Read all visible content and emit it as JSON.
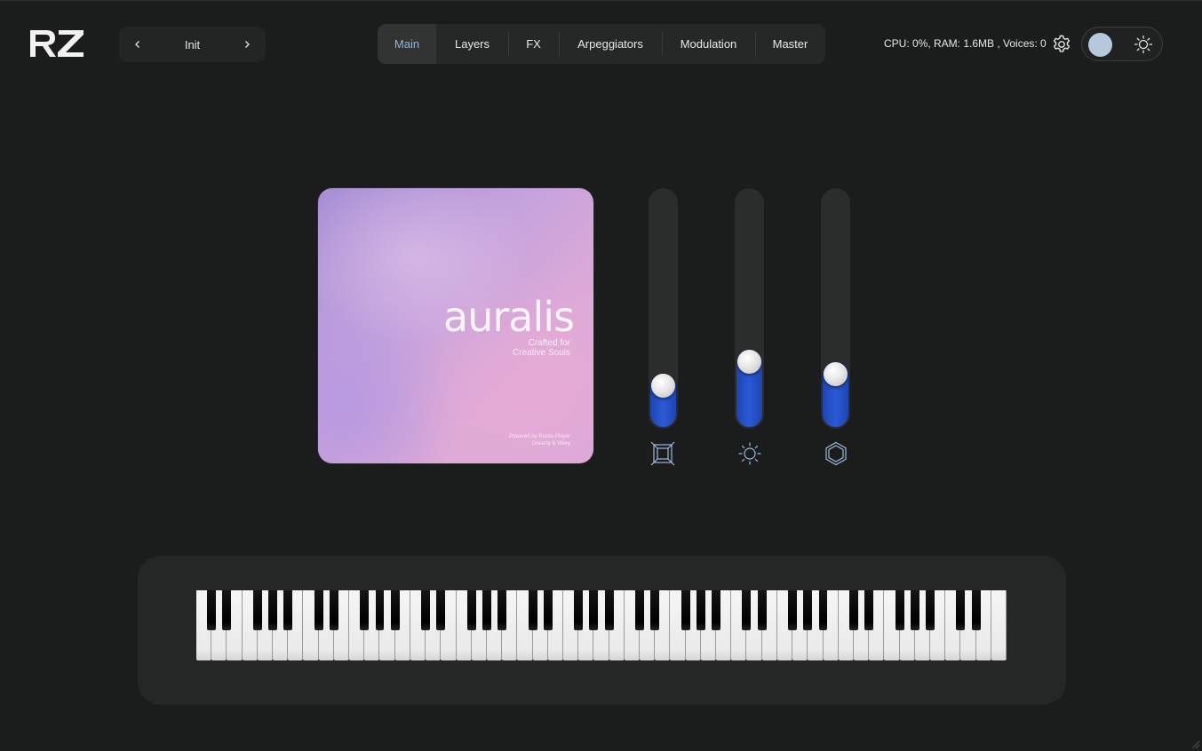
{
  "app": {
    "logo_text": "RZ"
  },
  "preset": {
    "name": "Init",
    "prev_icon": "chevron-left-icon",
    "next_icon": "chevron-right-icon"
  },
  "tabs": [
    {
      "label": "Main",
      "active": true
    },
    {
      "label": "Layers",
      "active": false
    },
    {
      "label": "FX",
      "active": false
    },
    {
      "label": "Arpeggiators",
      "active": false
    },
    {
      "label": "Modulation",
      "active": false
    },
    {
      "label": "Master",
      "active": false
    }
  ],
  "status": {
    "text": "CPU: 0%, RAM: 1.6MB , Voices: 0"
  },
  "header_icons": {
    "settings": "gear-icon",
    "theme_toggle_knob": "toggle-knob",
    "theme": "sun-icon"
  },
  "artwork": {
    "title": "auralis",
    "tagline_line1": "Crafted for",
    "tagline_line2": "Creative Souls",
    "footer_line1": "Powered by Rozos Player",
    "footer_line2": "Dreamy & Vibey"
  },
  "sliders": [
    {
      "icon": "square-frame-icon",
      "level": 0.14
    },
    {
      "icon": "sun-icon",
      "level": 0.24
    },
    {
      "icon": "hexagon-icon",
      "level": 0.19
    }
  ],
  "colors": {
    "accent": "#2b5ad6",
    "active_tab_text": "#8fb4e6",
    "background": "#1b1c1c",
    "panel": "#252626"
  },
  "keyboard": {
    "white_key_count": 53
  }
}
